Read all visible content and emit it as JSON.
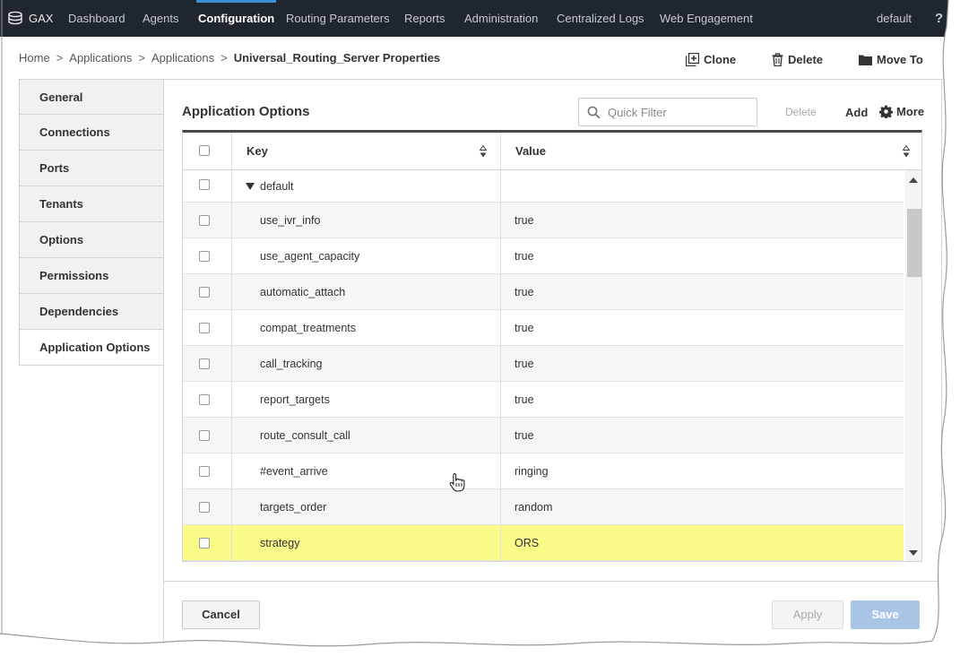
{
  "topnav": {
    "logo": "GAX",
    "items": [
      "Dashboard",
      "Agents",
      "Configuration",
      "Routing Parameters",
      "Reports",
      "Administration",
      "Centralized Logs",
      "Web Engagement"
    ],
    "active": "Configuration",
    "user": "default",
    "help": "?"
  },
  "breadcrumb": {
    "items": [
      "Home",
      "Applications",
      "Applications"
    ],
    "separator": ">",
    "current": "Universal_Routing_Server Properties"
  },
  "toolbar": {
    "clone": "Clone",
    "delete": "Delete",
    "move_to": "Move To"
  },
  "sidenav": {
    "tabs": [
      "General",
      "Connections",
      "Ports",
      "Tenants",
      "Options",
      "Permissions",
      "Dependencies",
      "Application Options"
    ],
    "active": "Application Options"
  },
  "panel": {
    "title": "Application Options",
    "quick_filter_placeholder": "Quick Filter",
    "delete": "Delete",
    "add": "Add",
    "more": "More"
  },
  "grid": {
    "columns": {
      "key": "Key",
      "value": "Value"
    },
    "group": "default",
    "rows": [
      {
        "key": "use_ivr_info",
        "value": "true"
      },
      {
        "key": "use_agent_capacity",
        "value": "true"
      },
      {
        "key": "automatic_attach",
        "value": "true"
      },
      {
        "key": "compat_treatments",
        "value": "true"
      },
      {
        "key": "call_tracking",
        "value": "true"
      },
      {
        "key": "report_targets",
        "value": "true"
      },
      {
        "key": "route_consult_call",
        "value": "true"
      },
      {
        "key": "#event_arrive",
        "value": "ringing"
      },
      {
        "key": "targets_order",
        "value": "random"
      },
      {
        "key": "strategy",
        "value": "ORS"
      }
    ],
    "highlighted_row": "strategy"
  },
  "footer": {
    "cancel": "Cancel",
    "apply": "Apply",
    "save": "Save"
  },
  "colors": {
    "topbar": "#1f262d",
    "accent": "#3a8fd6",
    "highlight": "#fbfb8a",
    "save_disabled": "#a9c5e6"
  }
}
